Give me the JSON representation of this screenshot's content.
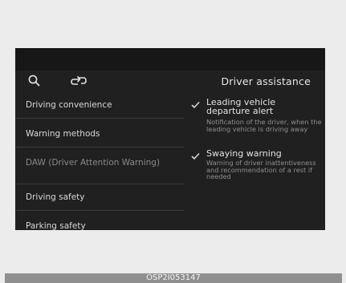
{
  "header": {
    "title": "Driver assistance",
    "icons": [
      "search-icon",
      "back-icon"
    ]
  },
  "menu": {
    "items": [
      {
        "label": "Driving convenience",
        "state": "normal"
      },
      {
        "label": "Warning methods",
        "state": "normal"
      },
      {
        "label": "DAW (Driver Attention Warning)",
        "state": "dimmed"
      },
      {
        "label": "Driving safety",
        "state": "normal"
      },
      {
        "label": "Parking safety",
        "state": "normal"
      }
    ]
  },
  "options": [
    {
      "title": "Leading vehicle departure alert",
      "description": "Notification of the driver, when the leading vehicle is driving away",
      "checked": true
    },
    {
      "title": "Swaying warning",
      "description": "Warning of driver inattentiveness and recommendation of a rest if needed",
      "checked": true
    }
  ],
  "caption": "OSP2I053147"
}
